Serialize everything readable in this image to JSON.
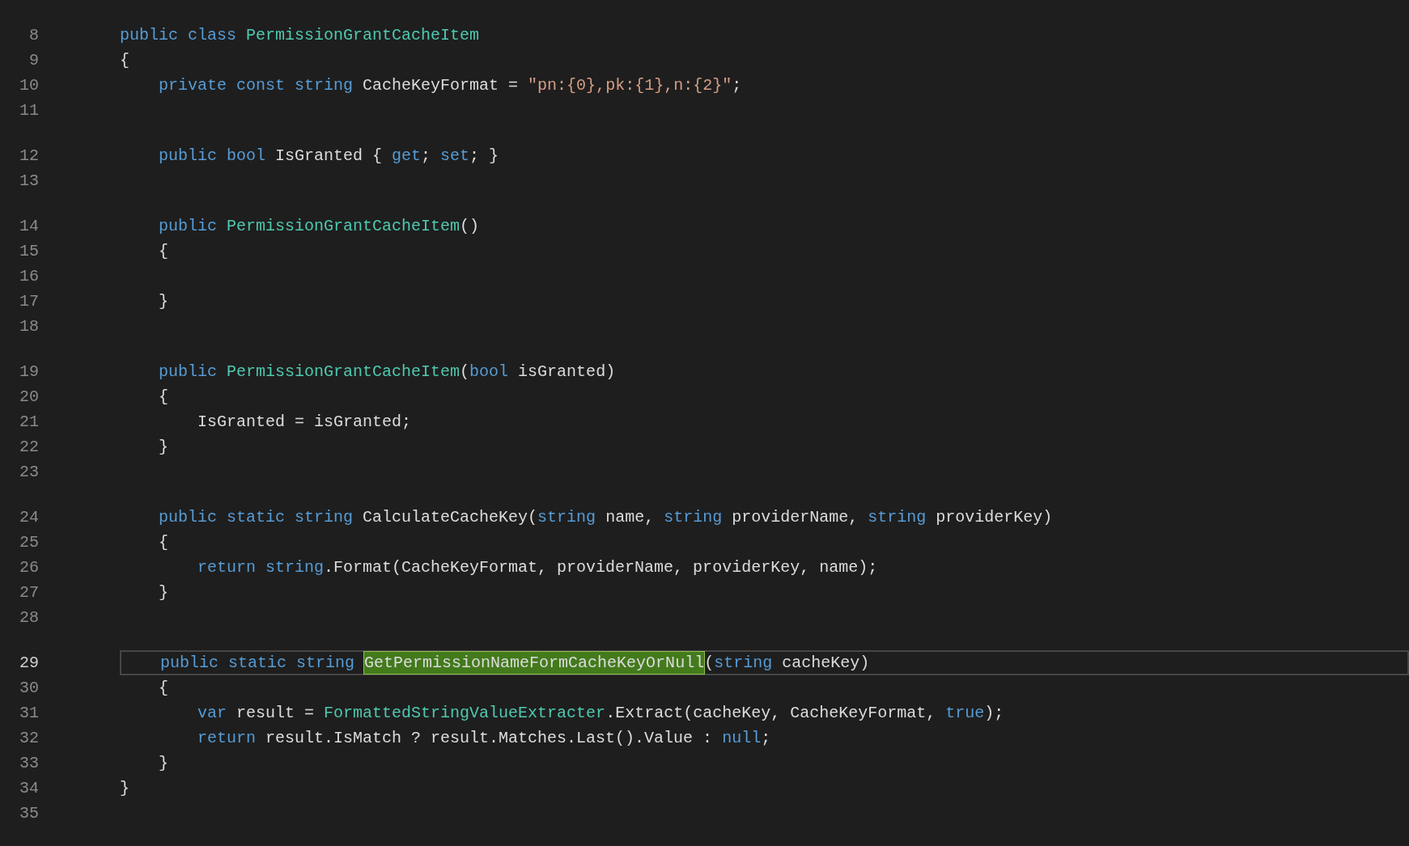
{
  "editor": {
    "lines": [
      {
        "number": "8",
        "space_above": false,
        "current": false,
        "tokens": [
          {
            "kind": "keyword",
            "text": "public class "
          },
          {
            "kind": "type",
            "text": "PermissionGrantCacheItem"
          }
        ]
      },
      {
        "number": "9",
        "space_above": false,
        "current": false,
        "tokens": [
          {
            "kind": "plain",
            "text": "{"
          }
        ]
      },
      {
        "number": "10",
        "space_above": false,
        "current": false,
        "tokens": [
          {
            "kind": "keyword",
            "text": "    private const string "
          },
          {
            "kind": "plain",
            "text": "CacheKeyFormat = "
          },
          {
            "kind": "string",
            "text": "\"pn:{0},pk:{1},n:{2}\""
          },
          {
            "kind": "plain",
            "text": ";"
          }
        ]
      },
      {
        "number": "11",
        "space_above": false,
        "current": false
      },
      {
        "number": "12",
        "space_above": true,
        "current": false,
        "tokens": [
          {
            "kind": "keyword",
            "text": "    public bool "
          },
          {
            "kind": "plain",
            "text": "IsGranted { "
          },
          {
            "kind": "keyword",
            "text": "get"
          },
          {
            "kind": "plain",
            "text": "; "
          },
          {
            "kind": "keyword",
            "text": "set"
          },
          {
            "kind": "plain",
            "text": "; }"
          }
        ]
      },
      {
        "number": "13",
        "space_above": false,
        "current": false
      },
      {
        "number": "14",
        "space_above": true,
        "current": false,
        "tokens": [
          {
            "kind": "keyword",
            "text": "    public "
          },
          {
            "kind": "type",
            "text": "PermissionGrantCacheItem"
          },
          {
            "kind": "plain",
            "text": "()"
          }
        ]
      },
      {
        "number": "15",
        "space_above": false,
        "current": false,
        "tokens": [
          {
            "kind": "plain",
            "text": "    {"
          }
        ]
      },
      {
        "number": "16",
        "space_above": false,
        "current": false
      },
      {
        "number": "17",
        "space_above": false,
        "current": false,
        "tokens": [
          {
            "kind": "plain",
            "text": "    }"
          }
        ]
      },
      {
        "number": "18",
        "space_above": false,
        "current": false
      },
      {
        "number": "19",
        "space_above": true,
        "current": false,
        "tokens": [
          {
            "kind": "keyword",
            "text": "    public "
          },
          {
            "kind": "type",
            "text": "PermissionGrantCacheItem"
          },
          {
            "kind": "plain",
            "text": "("
          },
          {
            "kind": "keyword",
            "text": "bool "
          },
          {
            "kind": "plain",
            "text": "isGranted)"
          }
        ]
      },
      {
        "number": "20",
        "space_above": false,
        "current": false,
        "tokens": [
          {
            "kind": "plain",
            "text": "    {"
          }
        ]
      },
      {
        "number": "21",
        "space_above": false,
        "current": false,
        "tokens": [
          {
            "kind": "plain",
            "text": "        IsGranted = isGranted;"
          }
        ]
      },
      {
        "number": "22",
        "space_above": false,
        "current": false,
        "tokens": [
          {
            "kind": "plain",
            "text": "    }"
          }
        ]
      },
      {
        "number": "23",
        "space_above": false,
        "current": false
      },
      {
        "number": "24",
        "space_above": true,
        "current": false,
        "tokens": [
          {
            "kind": "keyword",
            "text": "    public static string "
          },
          {
            "kind": "plain",
            "text": "CalculateCacheKey("
          },
          {
            "kind": "keyword",
            "text": "string "
          },
          {
            "kind": "plain",
            "text": "name, "
          },
          {
            "kind": "keyword",
            "text": "string "
          },
          {
            "kind": "plain",
            "text": "providerName, "
          },
          {
            "kind": "keyword",
            "text": "string "
          },
          {
            "kind": "plain",
            "text": "providerKey)"
          }
        ]
      },
      {
        "number": "25",
        "space_above": false,
        "current": false,
        "tokens": [
          {
            "kind": "plain",
            "text": "    {"
          }
        ]
      },
      {
        "number": "26",
        "space_above": false,
        "current": false,
        "tokens": [
          {
            "kind": "keyword",
            "text": "        return string"
          },
          {
            "kind": "plain",
            "text": ".Format(CacheKeyFormat, providerName, providerKey, name);"
          }
        ]
      },
      {
        "number": "27",
        "space_above": false,
        "current": false,
        "tokens": [
          {
            "kind": "plain",
            "text": "    }"
          }
        ]
      },
      {
        "number": "28",
        "space_above": false,
        "current": false
      },
      {
        "number": "29",
        "space_above": true,
        "current": true,
        "tokens": [
          {
            "kind": "keyword",
            "text": "    public static string "
          },
          {
            "kind": "match",
            "text": "GetPermissionNameFormCacheKeyOrNull"
          },
          {
            "kind": "plain",
            "text": "("
          },
          {
            "kind": "keyword",
            "text": "string "
          },
          {
            "kind": "plain",
            "text": "cacheKey)"
          }
        ]
      },
      {
        "number": "30",
        "space_above": false,
        "current": false,
        "tokens": [
          {
            "kind": "plain",
            "text": "    {"
          }
        ]
      },
      {
        "number": "31",
        "space_above": false,
        "current": false,
        "tokens": [
          {
            "kind": "keyword",
            "text": "        var "
          },
          {
            "kind": "plain",
            "text": "result = "
          },
          {
            "kind": "type",
            "text": "FormattedStringValueExtracter"
          },
          {
            "kind": "plain",
            "text": ".Extract(cacheKey, CacheKeyFormat, "
          },
          {
            "kind": "keyword",
            "text": "true"
          },
          {
            "kind": "plain",
            "text": ");"
          }
        ]
      },
      {
        "number": "32",
        "space_above": false,
        "current": false,
        "tokens": [
          {
            "kind": "keyword",
            "text": "        return "
          },
          {
            "kind": "plain",
            "text": "result.IsMatch ? result.Matches.Last().Value : "
          },
          {
            "kind": "keyword",
            "text": "null"
          },
          {
            "kind": "plain",
            "text": ";"
          }
        ]
      },
      {
        "number": "33",
        "space_above": false,
        "current": false,
        "tokens": [
          {
            "kind": "plain",
            "text": "    }"
          }
        ]
      },
      {
        "number": "34",
        "space_above": false,
        "current": false,
        "tokens": [
          {
            "kind": "plain",
            "text": "}"
          }
        ]
      },
      {
        "number": "35",
        "space_above": false,
        "current": false
      }
    ]
  }
}
